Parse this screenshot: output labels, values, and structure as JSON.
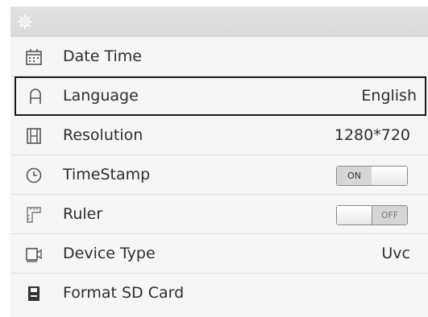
{
  "header": {
    "icon": "gear-icon"
  },
  "menu": {
    "items": [
      {
        "label": "Date Time",
        "value": "",
        "icon": "calendar-icon"
      },
      {
        "label": "Language",
        "value": "English",
        "icon": "language-icon"
      },
      {
        "label": "Resolution",
        "value": "1280*720",
        "icon": "film-icon"
      },
      {
        "label": "TimeStamp",
        "value": "ON",
        "icon": "clock-icon"
      },
      {
        "label": "Ruler",
        "value": "OFF",
        "icon": "ruler-icon"
      },
      {
        "label": "Device Type",
        "value": "Uvc",
        "icon": "camera-icon"
      },
      {
        "label": "Format SD Card",
        "value": "",
        "icon": "sd-card-icon"
      }
    ],
    "selected_label": "Language"
  }
}
